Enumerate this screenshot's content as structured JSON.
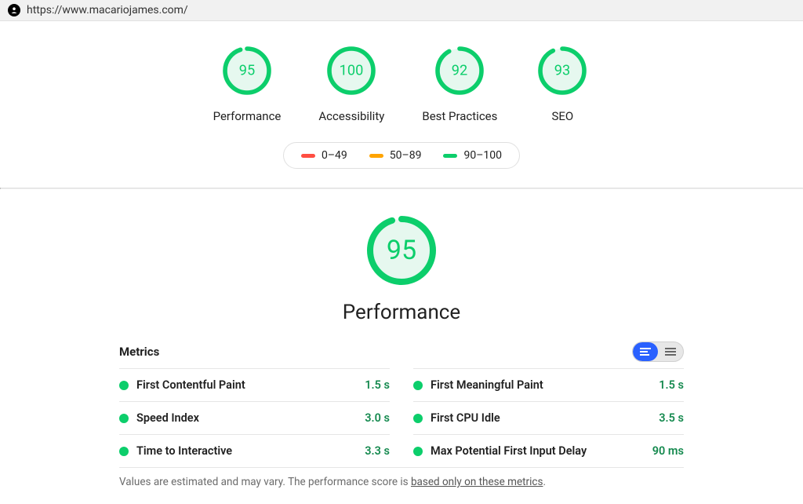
{
  "url": "https://www.macariojames.com/",
  "gauges": [
    {
      "label": "Performance",
      "score": 95
    },
    {
      "label": "Accessibility",
      "score": 100
    },
    {
      "label": "Best Practices",
      "score": 92
    },
    {
      "label": "SEO",
      "score": 93
    }
  ],
  "legend": {
    "red": "0–49",
    "orange": "50–89",
    "green": "90–100"
  },
  "main_gauge": {
    "label": "Performance",
    "score": 95
  },
  "metrics_title": "Metrics",
  "metrics_left": [
    {
      "name": "First Contentful Paint",
      "value": "1.5 s"
    },
    {
      "name": "Speed Index",
      "value": "3.0 s"
    },
    {
      "name": "Time to Interactive",
      "value": "3.3 s"
    }
  ],
  "metrics_right": [
    {
      "name": "First Meaningful Paint",
      "value": "1.5 s"
    },
    {
      "name": "First CPU Idle",
      "value": "3.5 s"
    },
    {
      "name": "Max Potential First Input Delay",
      "value": "90 ms"
    }
  ],
  "footnote": {
    "prefix": "Values are estimated and may vary. The performance score is ",
    "link": "based only on these metrics",
    "suffix": "."
  },
  "colors": {
    "green": "#0cce6b",
    "orange": "#ffa400",
    "red": "#ff4e42",
    "blue": "#2a61ff"
  },
  "chart_data": [
    {
      "type": "pie",
      "title": "Performance",
      "series": [
        {
          "name": "score",
          "values": [
            95,
            5
          ]
        }
      ],
      "categories": [
        "score",
        "remaining"
      ],
      "ylim": [
        0,
        100
      ]
    },
    {
      "type": "pie",
      "title": "Accessibility",
      "series": [
        {
          "name": "score",
          "values": [
            100,
            0
          ]
        }
      ],
      "categories": [
        "score",
        "remaining"
      ],
      "ylim": [
        0,
        100
      ]
    },
    {
      "type": "pie",
      "title": "Best Practices",
      "series": [
        {
          "name": "score",
          "values": [
            92,
            8
          ]
        }
      ],
      "categories": [
        "score",
        "remaining"
      ],
      "ylim": [
        0,
        100
      ]
    },
    {
      "type": "pie",
      "title": "SEO",
      "series": [
        {
          "name": "score",
          "values": [
            93,
            7
          ]
        }
      ],
      "categories": [
        "score",
        "remaining"
      ],
      "ylim": [
        0,
        100
      ]
    },
    {
      "type": "table",
      "title": "Metrics",
      "categories": [
        "First Contentful Paint",
        "Speed Index",
        "Time to Interactive",
        "First Meaningful Paint",
        "First CPU Idle",
        "Max Potential First Input Delay"
      ],
      "values": [
        "1.5 s",
        "3.0 s",
        "3.3 s",
        "1.5 s",
        "3.5 s",
        "90 ms"
      ]
    }
  ]
}
